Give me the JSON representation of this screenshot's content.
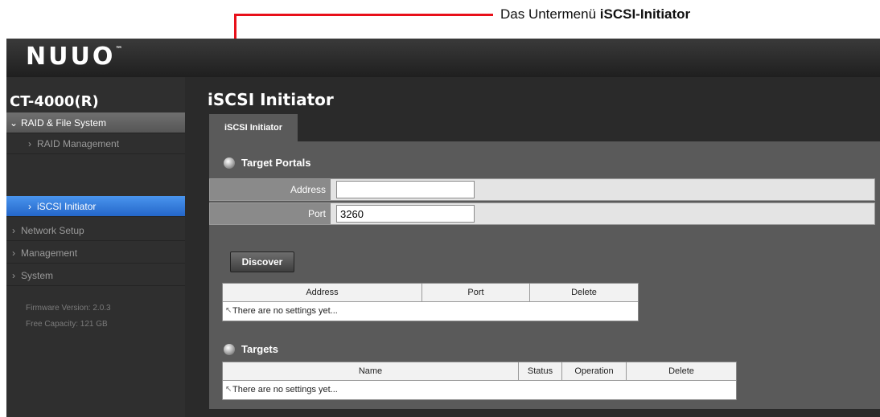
{
  "annotation": {
    "prefix": "Das Untermenü ",
    "emphasis": "iSCSI-Initiator",
    "color": "#e8101a"
  },
  "app": {
    "logo": "NUUO",
    "trademark": "™"
  },
  "sidebar": {
    "device_name": "CT-4000(R)",
    "items": [
      {
        "label": "RAID & File System",
        "icon": "chevron-down-icon"
      },
      {
        "label": "RAID Management",
        "icon": "chevron-right-icon"
      },
      {
        "label": "iSCSI Initiator",
        "icon": "chevron-right-icon",
        "active": true
      },
      {
        "label": "Network Setup",
        "icon": "chevron-right-icon"
      },
      {
        "label": "Management",
        "icon": "chevron-right-icon"
      },
      {
        "label": "System",
        "icon": "chevron-right-icon"
      }
    ],
    "firmware": "Firmware Version: 2.0.3",
    "capacity": "Free Capacity: 121 GB",
    "active_color": "#2f7ce0"
  },
  "main": {
    "title": "iSCSI Initiator",
    "tab_label": "iSCSI Initiator",
    "target_portals": {
      "heading": "Target Portals",
      "address_label": "Address",
      "address_value": "",
      "port_label": "Port",
      "port_value": "3260",
      "discover_button": "Discover",
      "table": {
        "columns": [
          "Address",
          "Port",
          "Delete"
        ],
        "empty_text": "There are no settings yet..."
      }
    },
    "targets": {
      "heading": "Targets",
      "table": {
        "columns": [
          "Name",
          "Status",
          "Operation",
          "Delete"
        ],
        "empty_text": "There are no settings yet..."
      }
    }
  }
}
